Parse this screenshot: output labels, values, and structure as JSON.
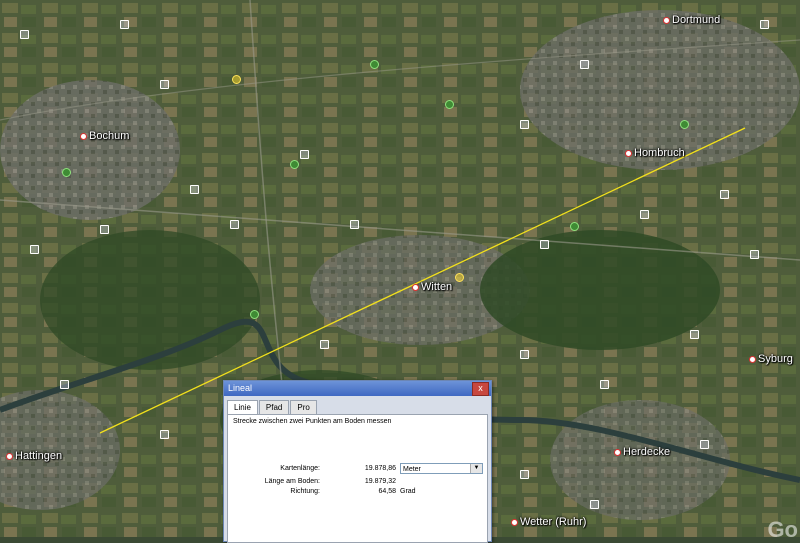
{
  "map": {
    "cities": [
      "Dortmund",
      "Bochum",
      "Hombruch",
      "Witten",
      "Syburg",
      "Hattingen",
      "Herdecke",
      "Wetter (Ruhr)"
    ],
    "watermark": "Go"
  },
  "dialog": {
    "title": "Lineal",
    "close_label": "x",
    "tabs": [
      "Linie",
      "Pfad",
      "Pro"
    ],
    "active_tab": "Linie",
    "instruction": "Strecke zwischen zwei Punkten am Boden messen",
    "map_length_label": "Kartenlänge:",
    "map_length_value": "19.878,86",
    "unit": "Meter",
    "ground_length_label": "Länge am Boden:",
    "ground_length_value": "19.879,32",
    "heading_label": "Richtung:",
    "heading_value": "64,58",
    "heading_unit": "Grad"
  },
  "colors": {
    "ruler_line": "#f2e01c",
    "titlebar": "#4a72c8"
  }
}
